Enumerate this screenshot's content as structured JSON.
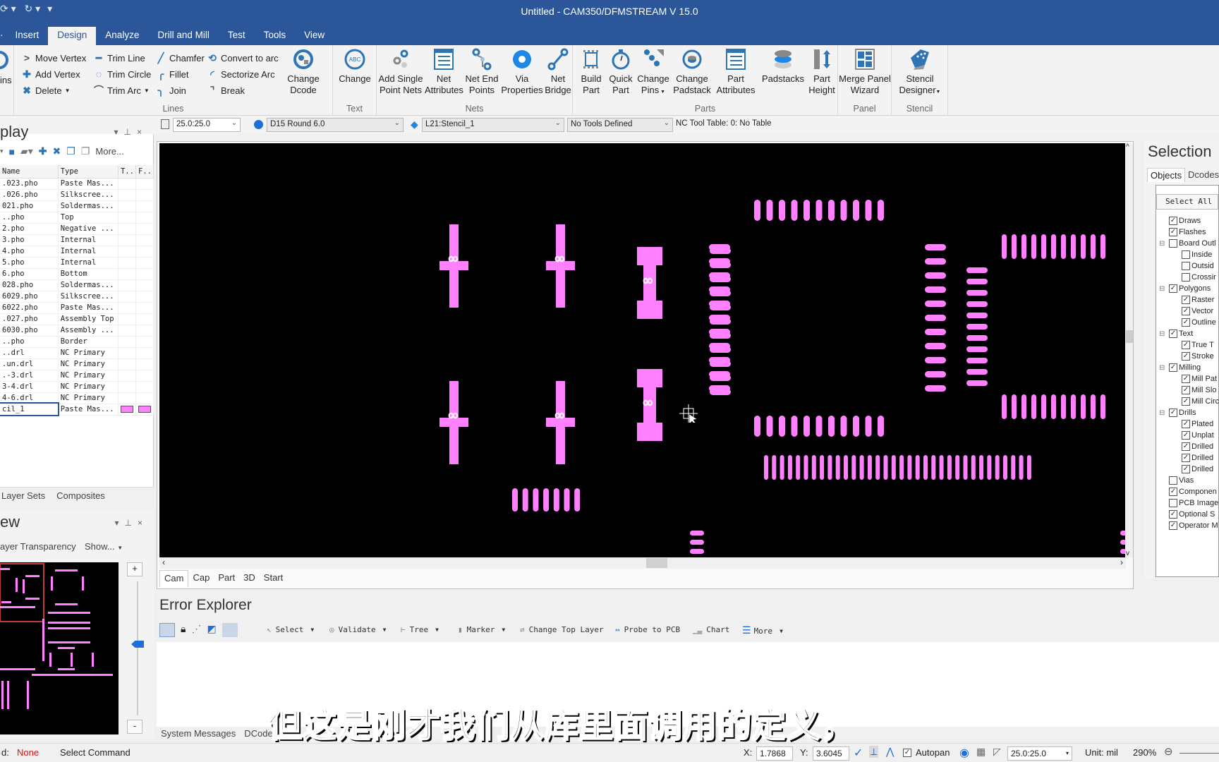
{
  "window": {
    "title": "Untitled - CAM350/DFMSTREAM V 15.0"
  },
  "ribbon": {
    "tabs": [
      "Insert",
      "Design",
      "Analyze",
      "Drill and Mill",
      "Test",
      "Tools",
      "View"
    ],
    "active_tab": "Design",
    "partial_left_label": "ins",
    "lines_group": {
      "label": "Lines",
      "buttons": [
        "Move Vertex",
        "Add Vertex",
        "Delete",
        "Trim Line",
        "Trim Circle",
        "Trim Arc",
        "Chamfer",
        "Fillet",
        "Join",
        "Convert to arc",
        "Sectorize Arc",
        "Break"
      ],
      "change_dcode": [
        "Change",
        "Dcode"
      ]
    },
    "text_group": {
      "label": "Text",
      "change": "Change"
    },
    "nets_group": {
      "label": "Nets",
      "buttons": [
        [
          "Add Single",
          "Point Nets"
        ],
        [
          "Net",
          "Attributes"
        ],
        [
          "Net End",
          "Points"
        ],
        [
          "Via",
          "Properties"
        ],
        [
          "Net",
          "Bridge"
        ]
      ]
    },
    "parts_group": {
      "label": "Parts",
      "buttons": [
        [
          "Build",
          "Part"
        ],
        [
          "Quick",
          "Part"
        ],
        [
          "Change",
          "Pins"
        ],
        [
          "Change",
          "Padstack"
        ],
        [
          "Part",
          "Attributes"
        ],
        [
          "Padstacks",
          ""
        ],
        [
          "Part",
          "Height"
        ]
      ]
    },
    "panel_group": {
      "label": "Panel",
      "buttons": [
        [
          "Merge Panel",
          "Wizard"
        ]
      ]
    },
    "stencil_group": {
      "label": "Stencil",
      "buttons": [
        [
          "Stencil",
          "Designer"
        ]
      ]
    }
  },
  "toolbar": {
    "grid": "25.0:25.0",
    "dcode": "D15   Round 6.0",
    "layer": "L21:Stencil_1",
    "tools": "No Tools Defined",
    "nc_table": "NC Tool Table: 0: No Table"
  },
  "layers_panel": {
    "title": "play",
    "more": "More...",
    "columns": [
      "Name",
      "Type",
      "T..",
      "F.."
    ],
    "rows": [
      {
        "name": ".023.pho",
        "type": "Paste Mas..."
      },
      {
        "name": ".026.pho",
        "type": "Silkscree..."
      },
      {
        "name": "021.pho",
        "type": "Soldermas..."
      },
      {
        "name": "..pho",
        "type": "Top"
      },
      {
        "name": "2.pho",
        "type": "Negative ..."
      },
      {
        "name": "3.pho",
        "type": "Internal"
      },
      {
        "name": "4.pho",
        "type": "Internal"
      },
      {
        "name": "5.pho",
        "type": "Internal"
      },
      {
        "name": "6.pho",
        "type": "Bottom"
      },
      {
        "name": "028.pho",
        "type": "Soldermas..."
      },
      {
        "name": "6029.pho",
        "type": "Silkscree..."
      },
      {
        "name": "6022.pho",
        "type": "Paste Mas..."
      },
      {
        "name": ".027.pho",
        "type": "Assembly Top"
      },
      {
        "name": "6030.pho",
        "type": "Assembly ..."
      },
      {
        "name": "..pho",
        "type": "Border"
      },
      {
        "name": "..drl",
        "type": "NC Primary"
      },
      {
        "name": ".un.drl",
        "type": "NC Primary"
      },
      {
        "name": ".-3.drl",
        "type": "NC Primary"
      },
      {
        "name": "3-4.drl",
        "type": "NC Primary"
      },
      {
        "name": "4-6.drl",
        "type": "NC Primary"
      },
      {
        "name": "cil_1",
        "type": "Paste Mas...",
        "selected": true,
        "color": "#ff80ff"
      }
    ],
    "tabs": [
      "Layer Sets",
      "Composites"
    ]
  },
  "overview_panel": {
    "title": "ew",
    "transparency": "ayer Transparency",
    "show": "Show...",
    "zoom_in": "+",
    "zoom_out": "-"
  },
  "canvas": {
    "pad_color": "#ff80ff",
    "tabs": [
      "Cam",
      "Cap",
      "Part",
      "3D",
      "Start"
    ],
    "active_tab": "Cam"
  },
  "selection_panel": {
    "title": "Selection",
    "tabs": [
      "Objects",
      "Dcodes"
    ],
    "select_all": "Select All",
    "tree": [
      {
        "label": "Draws",
        "checked": true,
        "level": 1
      },
      {
        "label": "Flashes",
        "checked": true,
        "level": 1
      },
      {
        "label": "Board Outl",
        "checked": false,
        "level": 1,
        "expander": true
      },
      {
        "label": "Inside",
        "checked": false,
        "level": 2
      },
      {
        "label": "Outsid",
        "checked": false,
        "level": 2
      },
      {
        "label": "Crossir",
        "checked": false,
        "level": 2
      },
      {
        "label": "Polygons",
        "checked": true,
        "level": 1,
        "expander": true
      },
      {
        "label": "Raster",
        "checked": true,
        "level": 2
      },
      {
        "label": "Vector",
        "checked": true,
        "level": 2
      },
      {
        "label": "Outline",
        "checked": true,
        "level": 2
      },
      {
        "label": "Text",
        "checked": true,
        "level": 1,
        "expander": true
      },
      {
        "label": "True T",
        "checked": true,
        "level": 2
      },
      {
        "label": "Stroke",
        "checked": true,
        "level": 2
      },
      {
        "label": "Milling",
        "checked": true,
        "level": 1,
        "expander": true
      },
      {
        "label": "Mill Pat",
        "checked": true,
        "level": 2
      },
      {
        "label": "Mill Slo",
        "checked": true,
        "level": 2
      },
      {
        "label": "Mill Circ",
        "checked": true,
        "level": 2
      },
      {
        "label": "Drills",
        "checked": true,
        "level": 1,
        "expander": true
      },
      {
        "label": "Plated",
        "checked": true,
        "level": 2
      },
      {
        "label": "Unplat",
        "checked": true,
        "level": 2
      },
      {
        "label": "Drilled",
        "checked": true,
        "level": 2
      },
      {
        "label": "Drilled",
        "checked": true,
        "level": 2
      },
      {
        "label": "Drilled",
        "checked": true,
        "level": 2
      },
      {
        "label": "Vias",
        "checked": false,
        "level": 1
      },
      {
        "label": "Componen",
        "checked": true,
        "level": 1
      },
      {
        "label": "PCB Image",
        "checked": false,
        "level": 1
      },
      {
        "label": "Optional S",
        "checked": true,
        "level": 1
      },
      {
        "label": "Operator M",
        "checked": true,
        "level": 1
      }
    ]
  },
  "error_explorer": {
    "title": "Error Explorer",
    "tools": [
      "Select",
      "Validate",
      "Tree",
      "Marker",
      "Change Top Layer",
      "Probe to PCB",
      "Chart",
      "More"
    ],
    "bottom_tabs": [
      "System Messages",
      "DCodes"
    ]
  },
  "status_bar": {
    "command_label": "d:",
    "command_value": "None",
    "prompt": "Select Command",
    "x_label": "X:",
    "x_value": "1.7868",
    "y_label": "Y:",
    "y_value": "3.6045",
    "autopan": "Autopan",
    "autopan_checked": true,
    "grid": "25.0:25.0",
    "unit": "Unit: mil",
    "zoom": "290%"
  },
  "subtitle": "但这是刚才我们从库里面调用的定义，"
}
